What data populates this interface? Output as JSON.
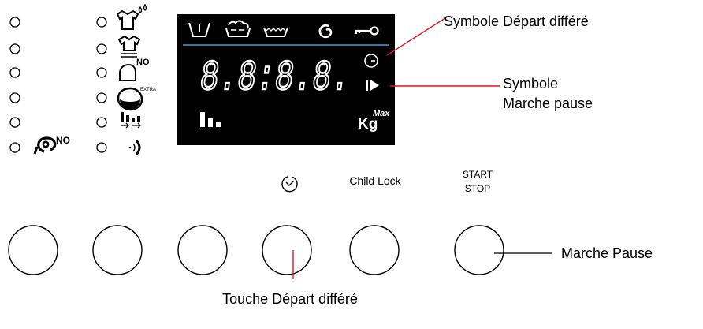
{
  "display": {
    "digits": "8.8:8.8.",
    "max_label": "Max",
    "kg_label": "Kg",
    "top_icons": [
      "prewash-icon",
      "main-wash-icon",
      "rinse-icon",
      "spin-icon",
      "door-lock-key-icon"
    ],
    "colors": {
      "background": "#000000",
      "foreground": "#ffffff",
      "separator": "#4aa0c8"
    }
  },
  "left_column_icons": [
    "no-spin-icon"
  ],
  "right_column_icons": [
    "stain-icon",
    "shirt-iron-icon",
    "no-iron-icon",
    "extra-rinse-icon",
    "bars-arrows-icon",
    "sound-icon"
  ],
  "button_labels": {
    "delay_timer_icon": "clock-icon",
    "child_lock": "Child Lock",
    "start_line1": "START",
    "start_line2": "STOP"
  },
  "callouts": {
    "delayed_start_symbol": "Symbole Départ différé",
    "pause_symbol_line1": "Symbole",
    "pause_symbol_line2": "Marche pause",
    "pause_button": "Marche Pause",
    "delay_button": "Touche Départ différé",
    "line_color": "#e0141e"
  }
}
